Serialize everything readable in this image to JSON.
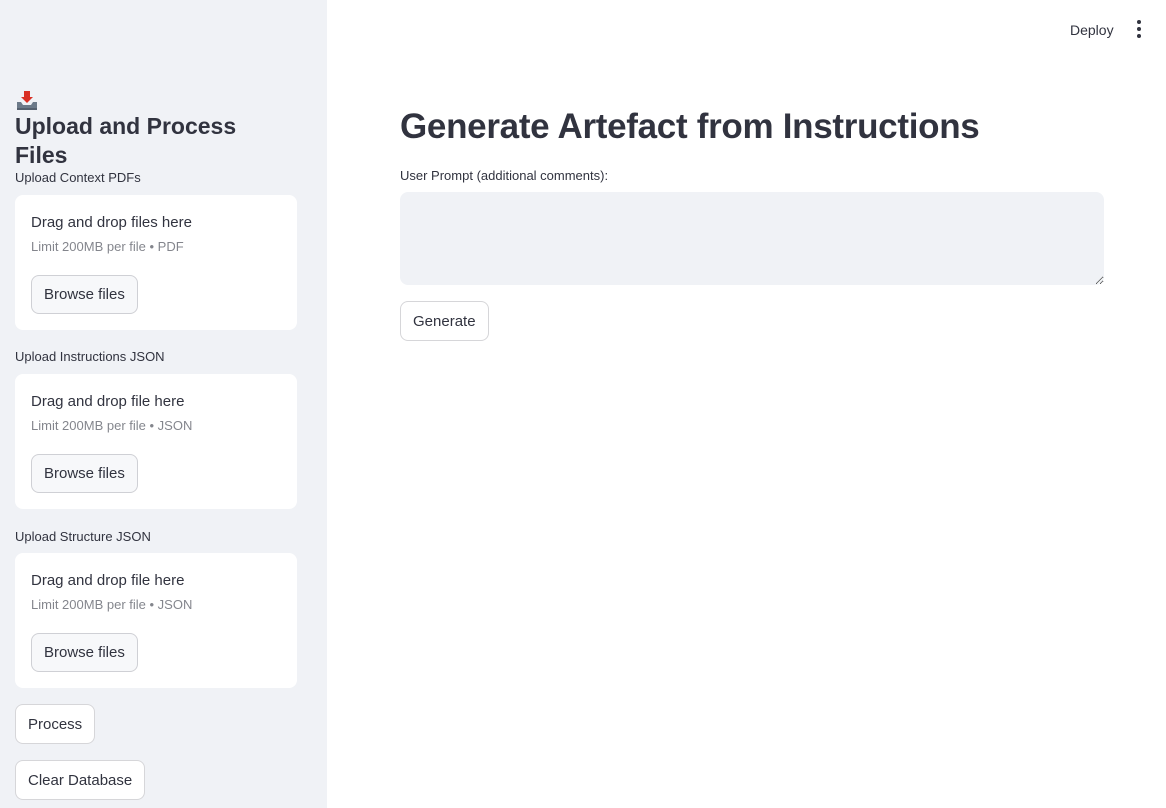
{
  "sidebar": {
    "title_icon": "inbox-tray-icon",
    "title": "Upload and Process Files",
    "uploaders": [
      {
        "label": "Upload Context PDFs",
        "drop_text": "Drag and drop files here",
        "limit_text": "Limit 200MB per file • PDF",
        "browse_label": "Browse files"
      },
      {
        "label": "Upload Instructions JSON",
        "drop_text": "Drag and drop file here",
        "limit_text": "Limit 200MB per file • JSON",
        "browse_label": "Browse files"
      },
      {
        "label": "Upload Structure JSON",
        "drop_text": "Drag and drop file here",
        "limit_text": "Limit 200MB per file • JSON",
        "browse_label": "Browse files"
      }
    ],
    "process_label": "Process",
    "clear_label": "Clear Database"
  },
  "header": {
    "deploy_label": "Deploy",
    "menu_icon": "vertical-dots-icon"
  },
  "main": {
    "title": "Generate Artefact from Instructions",
    "prompt_label": "User Prompt (additional comments):",
    "prompt_value": "",
    "generate_label": "Generate"
  }
}
